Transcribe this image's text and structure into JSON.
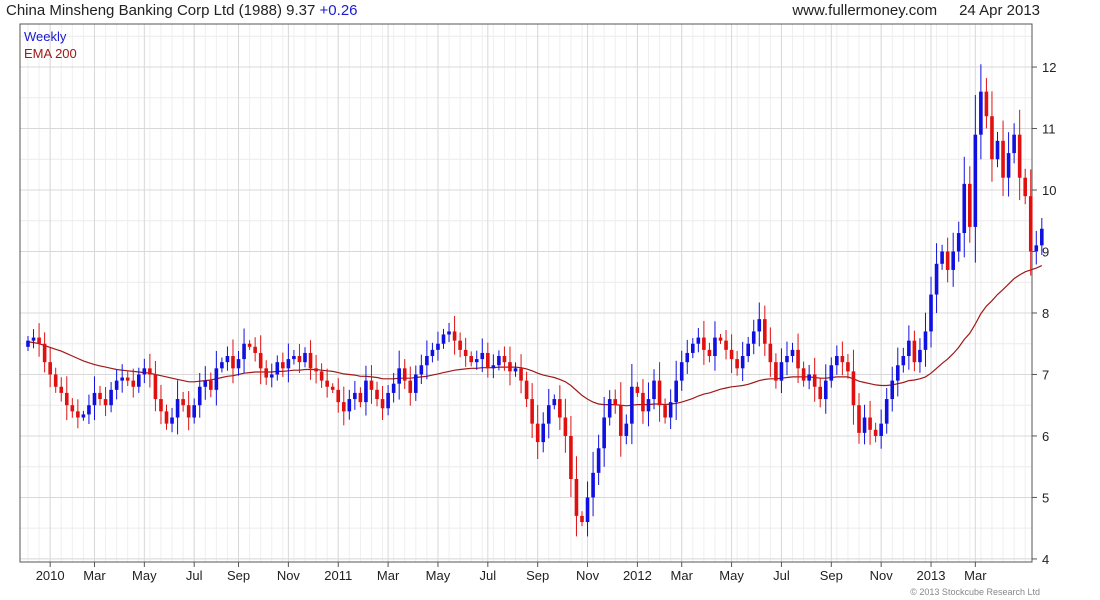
{
  "header": {
    "title": "China Minsheng Banking Corp Ltd (1988)",
    "price": "9.37",
    "change": "+0.26",
    "site": "www.fullermoney.com",
    "date": "24 Apr 2013"
  },
  "footer": {
    "copyright": "© 2013 Stockcube Research Ltd"
  },
  "colors": {
    "up": "#1010e0",
    "down": "#e01010",
    "ema": "#a01818",
    "grid": "#d8d8d8"
  },
  "chart_data": {
    "type": "candlestick",
    "interval": "Weekly",
    "legend": [
      {
        "name": "Weekly",
        "color": "#1a1ad0"
      },
      {
        "name": "EMA 200",
        "color": "#a01818"
      }
    ],
    "ylim": [
      3.95,
      12.7
    ],
    "y_ticks": [
      4,
      5,
      6,
      7,
      8,
      9,
      10,
      11,
      12
    ],
    "x_ticks": [
      {
        "label": "2010",
        "index": 4
      },
      {
        "label": "Mar",
        "index": 12
      },
      {
        "label": "May",
        "index": 21
      },
      {
        "label": "Jul",
        "index": 30
      },
      {
        "label": "Sep",
        "index": 38
      },
      {
        "label": "Nov",
        "index": 47
      },
      {
        "label": "2011",
        "index": 56
      },
      {
        "label": "Mar",
        "index": 65
      },
      {
        "label": "May",
        "index": 74
      },
      {
        "label": "Jul",
        "index": 83
      },
      {
        "label": "Sep",
        "index": 92
      },
      {
        "label": "Nov",
        "index": 101
      },
      {
        "label": "2012",
        "index": 110
      },
      {
        "label": "Mar",
        "index": 118
      },
      {
        "label": "May",
        "index": 127
      },
      {
        "label": "Jul",
        "index": 136
      },
      {
        "label": "Sep",
        "index": 145
      },
      {
        "label": "Nov",
        "index": 154
      },
      {
        "label": "2013",
        "index": 163
      },
      {
        "label": "Mar",
        "index": 171
      }
    ],
    "close": [
      7.55,
      7.6,
      7.5,
      7.2,
      7.0,
      6.8,
      6.7,
      6.5,
      6.4,
      6.3,
      6.35,
      6.5,
      6.7,
      6.6,
      6.5,
      6.75,
      6.9,
      6.95,
      6.9,
      6.8,
      7.0,
      7.1,
      7.0,
      6.6,
      6.4,
      6.2,
      6.3,
      6.6,
      6.5,
      6.3,
      6.5,
      6.8,
      6.9,
      6.75,
      7.1,
      7.2,
      7.3,
      7.1,
      7.25,
      7.5,
      7.45,
      7.35,
      7.1,
      6.95,
      7.0,
      7.2,
      7.1,
      7.25,
      7.3,
      7.2,
      7.35,
      7.1,
      7.05,
      6.9,
      6.8,
      6.75,
      6.55,
      6.4,
      6.6,
      6.7,
      6.55,
      6.9,
      6.75,
      6.6,
      6.45,
      6.7,
      6.85,
      7.1,
      6.9,
      6.7,
      7.0,
      7.15,
      7.3,
      7.4,
      7.5,
      7.65,
      7.7,
      7.55,
      7.4,
      7.3,
      7.2,
      7.25,
      7.35,
      7.1,
      7.15,
      7.3,
      7.2,
      7.05,
      7.1,
      6.9,
      6.6,
      6.2,
      5.9,
      6.2,
      6.5,
      6.6,
      6.3,
      6.0,
      5.3,
      4.7,
      4.6,
      5.0,
      5.4,
      5.8,
      6.3,
      6.6,
      6.5,
      6.0,
      6.2,
      6.8,
      6.7,
      6.4,
      6.6,
      6.9,
      6.5,
      6.3,
      6.55,
      6.9,
      7.2,
      7.35,
      7.5,
      7.6,
      7.4,
      7.3,
      7.6,
      7.55,
      7.4,
      7.25,
      7.1,
      7.3,
      7.5,
      7.7,
      7.9,
      7.5,
      7.2,
      6.9,
      7.2,
      7.3,
      7.4,
      7.1,
      6.9,
      7.0,
      6.8,
      6.6,
      6.9,
      7.15,
      7.3,
      7.2,
      7.05,
      6.5,
      6.05,
      6.3,
      6.1,
      6.0,
      6.2,
      6.6,
      6.9,
      7.15,
      7.3,
      7.55,
      7.2,
      7.4,
      7.7,
      8.3,
      8.8,
      9.0,
      8.7,
      9.0,
      9.3,
      10.1,
      9.4,
      10.9,
      11.6,
      11.2,
      10.5,
      10.8,
      10.2,
      10.6,
      10.9,
      10.2,
      9.9,
      9.0,
      9.1,
      9.37
    ],
    "ema": [
      7.53,
      7.52,
      7.5,
      7.47,
      7.44,
      7.41,
      7.38,
      7.34,
      7.3,
      7.26,
      7.22,
      7.19,
      7.16,
      7.14,
      7.12,
      7.1,
      7.08,
      7.07,
      7.06,
      7.05,
      7.04,
      7.03,
      7.02,
      7.0,
      6.98,
      6.96,
      6.94,
      6.92,
      6.9,
      6.88,
      6.88,
      6.89,
      6.9,
      6.91,
      6.93,
      6.95,
      6.97,
      6.98,
      7.0,
      7.02,
      7.03,
      7.04,
      7.04,
      7.04,
      7.04,
      7.05,
      7.05,
      7.06,
      7.07,
      7.07,
      7.08,
      7.08,
      7.08,
      7.07,
      7.06,
      7.05,
      7.03,
      7.01,
      7.0,
      6.99,
      6.97,
      6.97,
      6.96,
      6.95,
      6.93,
      6.93,
      6.93,
      6.94,
      6.94,
      6.94,
      6.95,
      6.96,
      6.97,
      6.99,
      7.01,
      7.03,
      7.05,
      7.07,
      7.08,
      7.09,
      7.1,
      7.1,
      7.11,
      7.11,
      7.11,
      7.12,
      7.12,
      7.12,
      7.12,
      7.11,
      7.09,
      7.06,
      7.02,
      6.99,
      6.97,
      6.95,
      6.92,
      6.88,
      6.82,
      6.74,
      6.66,
      6.6,
      6.55,
      6.52,
      6.51,
      6.51,
      6.51,
      6.5,
      6.49,
      6.5,
      6.51,
      6.51,
      6.51,
      6.52,
      6.52,
      6.51,
      6.52,
      6.53,
      6.55,
      6.58,
      6.61,
      6.65,
      6.68,
      6.7,
      6.73,
      6.76,
      6.78,
      6.8,
      6.81,
      6.82,
      6.84,
      6.87,
      6.9,
      6.92,
      6.93,
      6.93,
      6.94,
      6.95,
      6.96,
      6.96,
      6.96,
      6.96,
      6.95,
      6.94,
      6.94,
      6.95,
      6.96,
      6.96,
      6.96,
      6.93,
      6.89,
      6.87,
      6.85,
      6.83,
      6.82,
      6.82,
      6.83,
      6.85,
      6.87,
      6.9,
      6.91,
      6.93,
      6.96,
      7.02,
      7.1,
      7.18,
      7.25,
      7.34,
      7.44,
      7.57,
      7.67,
      7.82,
      7.99,
      8.11,
      8.2,
      8.3,
      8.38,
      8.47,
      8.56,
      8.62,
      8.67,
      8.7,
      8.73,
      8.77
    ]
  }
}
